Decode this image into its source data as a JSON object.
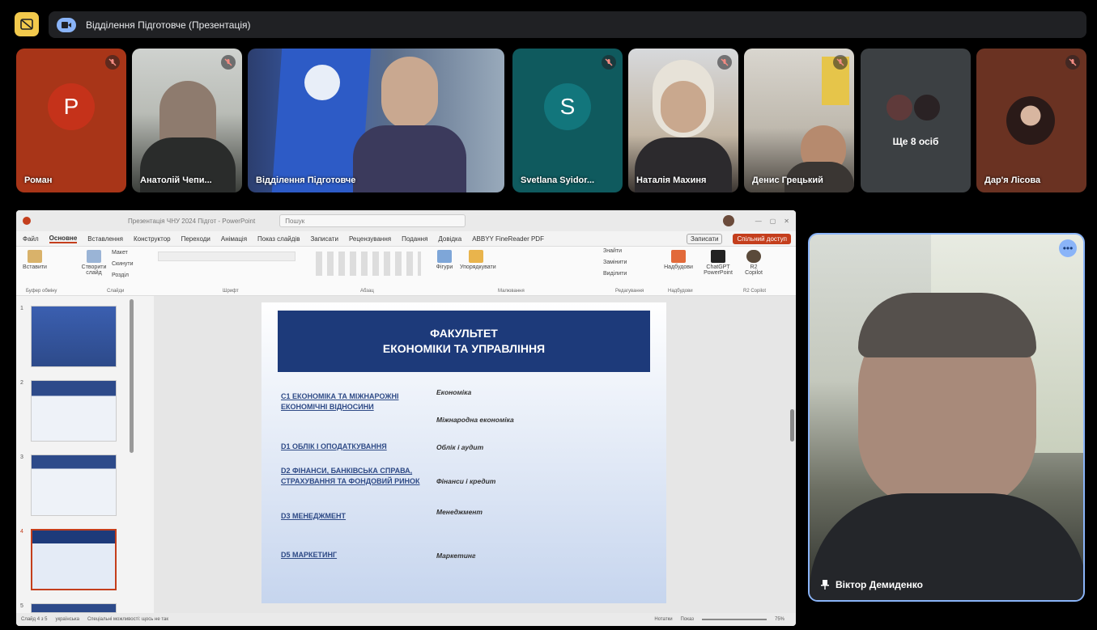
{
  "meeting": {
    "title": "Відділення Підготовче (Презентація)"
  },
  "participants": [
    {
      "name": "Роман",
      "initial": "P",
      "bg": "#a83518",
      "avatar_bg": "#c5321a",
      "muted": true
    },
    {
      "name": "Анатолій Чепи...",
      "muted": true
    },
    {
      "name": "Відділення Підготовче",
      "muted": false
    },
    {
      "name": "Svetlana Syidor...",
      "initial": "S",
      "bg": "#0f5a5e",
      "avatar_bg": "#12767c",
      "muted": true
    },
    {
      "name": "Наталія Махиня",
      "muted": true
    },
    {
      "name": "Денис Грецький",
      "muted": true
    },
    {
      "name": "Ще 8 осіб",
      "muted": false
    },
    {
      "name": "Дар'я Лісова",
      "muted": true
    }
  ],
  "powerpoint": {
    "title": "Презентація ЧНУ 2024 Підгот - PowerPoint",
    "search": "Пошук",
    "menu": [
      "Файл",
      "Основне",
      "Вставлення",
      "Конструктор",
      "Переходи",
      "Анімація",
      "Показ слайдів",
      "Записати",
      "Рецензування",
      "Подання",
      "Довідка",
      "ABBYY FineReader PDF"
    ],
    "record_label": "Записати",
    "share_label": "Спільний доступ",
    "ribbon": {
      "paste": "Вставити",
      "new_slide": "Створити слайд",
      "layout": "Макет",
      "reset": "Скинути",
      "section": "Розділ",
      "shapes": "Фігури",
      "arrange": "Упорядкувати",
      "find": "Знайти",
      "replace": "Замінити",
      "select": "Виділити",
      "addins": "Надбудови",
      "chatgpt": "ChatGPT PowerPoint",
      "copilot": "R2 Copilot",
      "groups": [
        "Буфер обміну",
        "Слайди",
        "Шрифт",
        "Абзац",
        "Малювання",
        "Редагування",
        "Надбудови",
        "R2 Copilot"
      ]
    },
    "slide": {
      "header_line1": "ФАКУЛЬТЕТ",
      "header_line2": "ЕКОНОМІКИ ТА УПРАВЛІННЯ",
      "specialties": [
        {
          "spec": "С1 ЕКОНОМІКА ТА МІЖНАРОЖНІ ЕКОНОМІЧНІ ВІДНОСИНИ",
          "programs": [
            "Економіка",
            "Міжнародна економіка"
          ]
        },
        {
          "spec": "D1 ОБЛІК І ОПОДАТКУВАННЯ",
          "programs": [
            "Облік і аудит"
          ]
        },
        {
          "spec": "D2 ФІНАНСИ, БАНКІВСЬКА СПРАВА, СТРАХУВАННЯ ТА ФОНДОВИЙ РИНОК",
          "programs": [
            "Фінанси і кредит"
          ]
        },
        {
          "spec": "D3 МЕНЕДЖМЕНТ",
          "programs": [
            "Менеджмент"
          ]
        },
        {
          "spec": "D5 МАРКЕТИНГ",
          "programs": [
            "Маркетинг"
          ]
        }
      ]
    },
    "thumbnails": [
      "1",
      "2",
      "3",
      "4",
      "5"
    ],
    "status": {
      "slide": "Слайд 4 з 5",
      "lang": "українська",
      "accessibility": "Спеціальні можливості: щось не так",
      "notes": "Нотатки",
      "display": "Показ",
      "zoom": "75%"
    }
  },
  "speaker": {
    "name": "Віктор Демиденко"
  }
}
